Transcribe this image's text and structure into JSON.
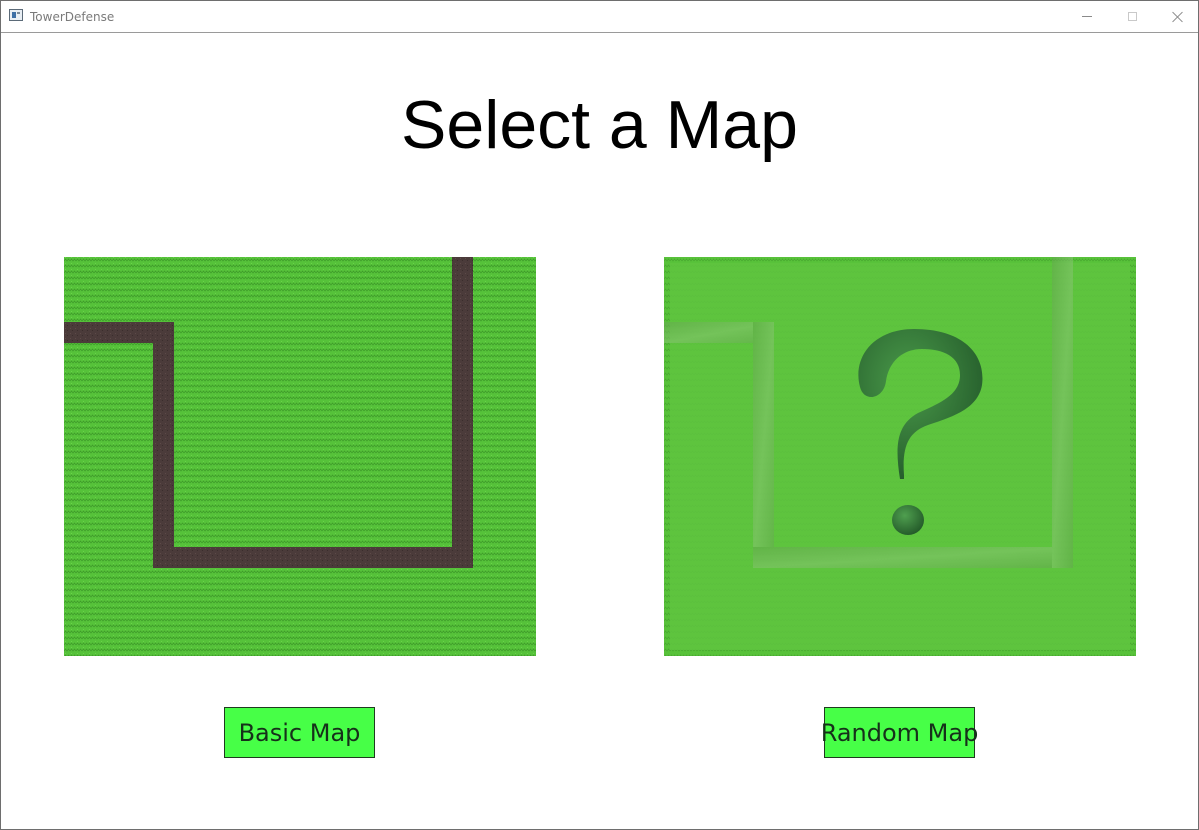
{
  "window": {
    "title": "TowerDefense",
    "app_icon": "window-app-icon",
    "controls": {
      "minimize_icon": "minimize-icon",
      "maximize_icon": "maximize-icon",
      "close_icon": "close-icon"
    }
  },
  "page": {
    "heading": "Select a Map"
  },
  "maps": [
    {
      "label": "Basic Map",
      "preview": "basic map preview with brown path on green grass"
    },
    {
      "label": "Random Map",
      "preview": "faded map with question mark icon"
    }
  ],
  "colors": {
    "grass": "#56c23a",
    "path": "#4b3b3a",
    "button_bg": "#47ff47",
    "question_mark": "#2f6b35"
  }
}
